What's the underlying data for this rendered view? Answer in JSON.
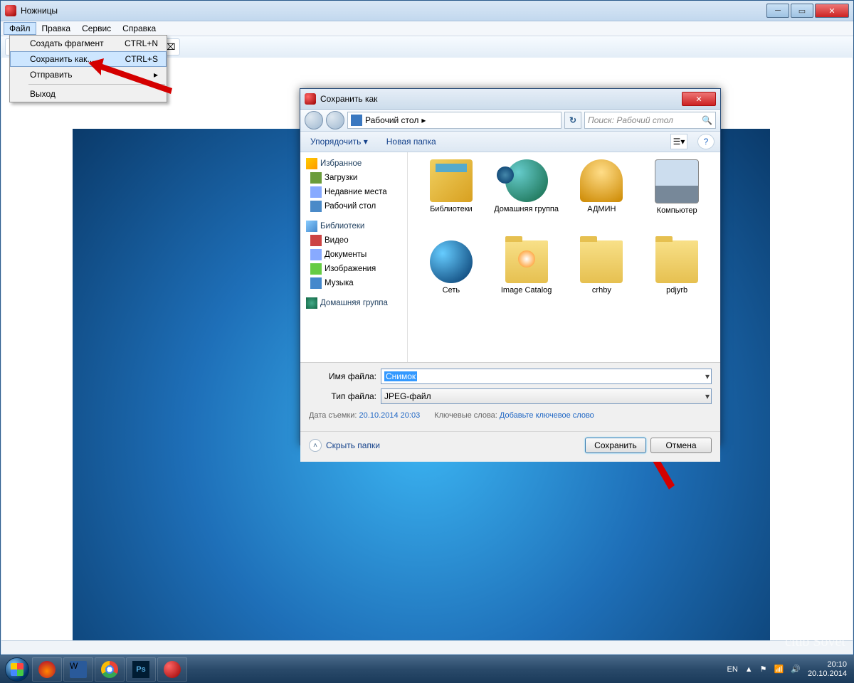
{
  "app": {
    "title": "Ножницы",
    "menu": {
      "file": "Файл",
      "edit": "Правка",
      "tools": "Сервис",
      "help": "Справка"
    },
    "dropdown": {
      "new": {
        "label": "Создать фрагмент",
        "accel": "CTRL+N"
      },
      "saveas": {
        "label": "Сохранить как...",
        "accel": "CTRL+S"
      },
      "send": {
        "label": "Отправить"
      },
      "exit": {
        "label": "Выход"
      }
    }
  },
  "dialog": {
    "title": "Сохранить как",
    "address": "Рабочий стол",
    "search_placeholder": "Поиск: Рабочий стол",
    "cmd": {
      "organize": "Упорядочить ▾",
      "newfolder": "Новая папка"
    },
    "tree": {
      "fav": "Избранное",
      "dl": "Загрузки",
      "recent": "Недавние места",
      "desk": "Рабочий стол",
      "libs": "Библиотеки",
      "video": "Видео",
      "docs": "Документы",
      "images": "Изображения",
      "music": "Музыка",
      "homegroup": "Домашняя группа"
    },
    "items": {
      "libraries": "Библиотеки",
      "homegroup": "Домашняя группа",
      "admin": "АДМИН",
      "computer": "Компьютер",
      "network": "Сеть",
      "imgcat": "Image Catalog",
      "f1": "crhby",
      "f2": "pdjyrb"
    },
    "form": {
      "name_label": "Имя файла:",
      "name_value": "Снимок",
      "type_label": "Тип файла:",
      "type_value": "JPEG-файл",
      "date_label": "Дата съемки:",
      "date_value": "20.10.2014 20:03",
      "tags_label": "Ключевые слова:",
      "tags_value": "Добавьте ключевое слово"
    },
    "actions": {
      "hide": "Скрыть папки",
      "save": "Сохранить",
      "cancel": "Отмена"
    }
  },
  "taskbar": {
    "lang": "EN",
    "time": "20:10",
    "date": "20.10.2014"
  },
  "watermark": "club Sovet"
}
